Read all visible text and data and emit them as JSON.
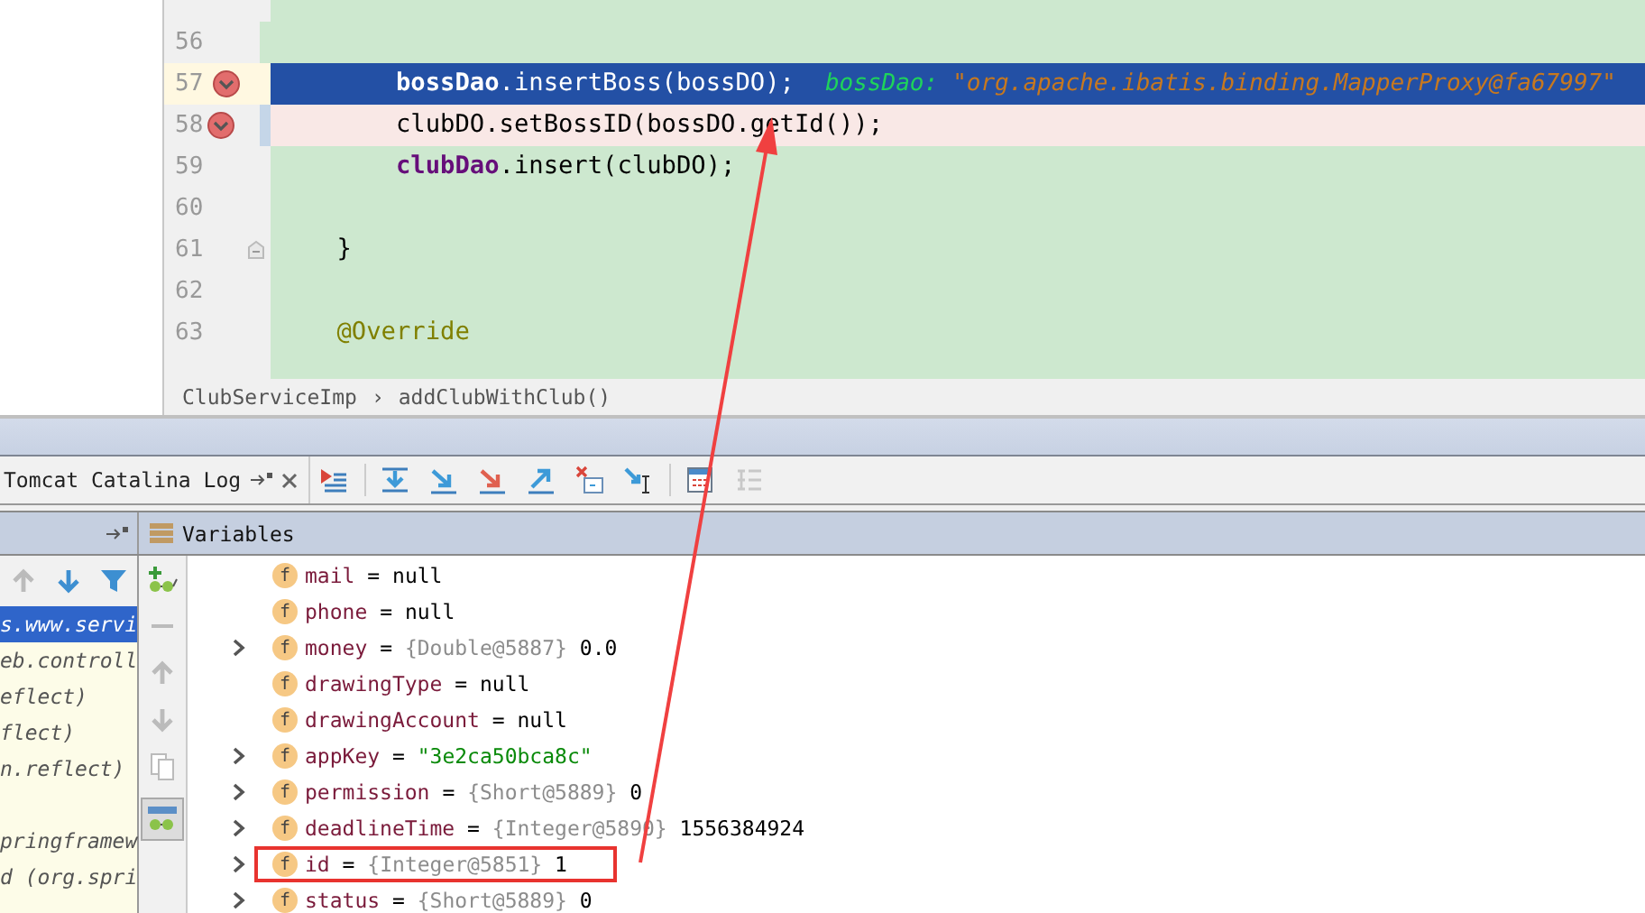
{
  "editor": {
    "lines": [
      {
        "number": "56",
        "current": false,
        "breakpoint": false,
        "color": "#cde8cf",
        "fold_marker": false,
        "override_marker": false
      },
      {
        "number": "57",
        "current": true,
        "breakpoint": true,
        "fold_marker": false,
        "override_marker": false,
        "tokens": [
          {
            "text": "        bossDao",
            "kind": "field"
          },
          {
            "text": ".insertBoss(bossDO);",
            "kind": "plain"
          },
          {
            "text": "bossDao:",
            "kind": "hint-name"
          },
          {
            "text": "\"org.apache.ibatis.binding.MapperProxy@fa67997\"",
            "kind": "hint-value"
          }
        ]
      },
      {
        "number": "58",
        "current": false,
        "breakpoint": true,
        "color": "#c5d6e8",
        "fold_marker": false,
        "override_marker": false,
        "tokens": [
          {
            "text": "        clubDO.setBossID(bossDO.getId());",
            "kind": "plain"
          }
        ]
      },
      {
        "number": "59",
        "current": false,
        "breakpoint": false,
        "fold_marker": false,
        "override_marker": false,
        "tokens": [
          {
            "text": "        clubDao",
            "kind": "field"
          },
          {
            "text": ".insert(clubDO);",
            "kind": "plain"
          }
        ]
      },
      {
        "number": "60",
        "current": false,
        "breakpoint": false,
        "fold_marker": false,
        "override_marker": false
      },
      {
        "number": "61",
        "current": false,
        "breakpoint": false,
        "fold_marker": true,
        "override_marker": false,
        "tokens": [
          {
            "text": "    }",
            "kind": "plain"
          }
        ]
      },
      {
        "number": "62",
        "current": false,
        "breakpoint": false,
        "fold_marker": false,
        "override_marker": false
      },
      {
        "number": "63",
        "current": false,
        "breakpoint": false,
        "fold_marker": false,
        "override_marker": false,
        "tokens": [
          {
            "text": "    @Override",
            "kind": "annotation"
          }
        ]
      }
    ],
    "breadcrumbs": {
      "items": [
        "ClubServiceImp",
        "addClubWithClub()"
      ],
      "separator": "›"
    }
  },
  "debugger": {
    "tab": {
      "label": "Tomcat Catalina Log",
      "selected": true
    },
    "frames": [
      {
        "text": "s.www.servi",
        "selected": true
      },
      {
        "text": "eb.controll",
        "selected": false
      },
      {
        "text": "eflect)",
        "selected": false
      },
      {
        "text": "flect)",
        "selected": false
      },
      {
        "text": "n.reflect)",
        "selected": false
      },
      {
        "selected": false
      },
      {
        "text": "pringframew",
        "selected": false
      },
      {
        "text": "d (org.spri",
        "selected": false
      }
    ],
    "variables_title": "Variables",
    "variables": [
      {
        "badge": "f",
        "name": "mail",
        "equals": "=",
        "expandable": false,
        "value": "null",
        "is_string": false,
        "highlighted": false
      },
      {
        "badge": "f",
        "name": "phone",
        "equals": "=",
        "expandable": false,
        "value": "null",
        "is_string": false,
        "highlighted": false
      },
      {
        "badge": "f",
        "name": "money",
        "equals": "=",
        "expandable": true,
        "type": "{Double@5887}",
        "value": "0.0",
        "is_string": false,
        "highlighted": false
      },
      {
        "badge": "f",
        "name": "drawingType",
        "equals": "=",
        "expandable": false,
        "value": "null",
        "is_string": false,
        "highlighted": false
      },
      {
        "badge": "f",
        "name": "drawingAccount",
        "equals": "=",
        "expandable": false,
        "value": "null",
        "is_string": false,
        "highlighted": false
      },
      {
        "badge": "f",
        "name": "appKey",
        "equals": "=",
        "expandable": true,
        "value": "\"3e2ca50bca8c\"",
        "is_string": true,
        "highlighted": false
      },
      {
        "badge": "f",
        "name": "permission",
        "equals": "=",
        "expandable": true,
        "type": "{Short@5889}",
        "value": "0",
        "is_string": false,
        "highlighted": false
      },
      {
        "badge": "f",
        "name": "deadlineTime",
        "equals": "=",
        "expandable": true,
        "type": "{Integer@5890}",
        "value": "1556384924",
        "is_string": false,
        "highlighted": false
      },
      {
        "badge": "f",
        "name": "id",
        "equals": "=",
        "expandable": true,
        "type": "{Integer@5851}",
        "value": "1",
        "is_string": false,
        "highlighted": true
      },
      {
        "badge": "f",
        "name": "status",
        "equals": "=",
        "expandable": true,
        "type": "{Short@5889}",
        "value": "0",
        "is_string": false,
        "highlighted": false
      }
    ]
  }
}
